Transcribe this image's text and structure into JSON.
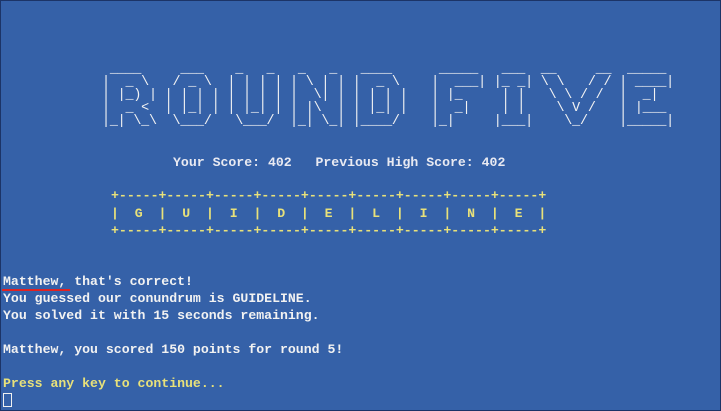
{
  "banner": {
    "title": "ROUND FIVE",
    "art": [
      " ____     ___    _   _   _   _   ____      _____   ___  __     __  _____ ",
      "|  _ \\   / _ \\  | | | | | \\ | | |  _ \\    |  ___| |_ _| \\ \\   / / | ____|",
      "| |_) | | | | | | | | | |  \\| | | | | |   | |_     | |   \\ \\ / /  |  _|  ",
      "|  _ <  | |_| | | |_| | | |\\  | | |_| |   |  _|    | |    \\ V /   | |___ ",
      "|_| \\_\\  \\___/   \\___/  |_| \\_| |____/    |_|     |___|    \\_/    |_____|"
    ]
  },
  "scores": {
    "line": "Your Score: 402   Previous High Score: 402"
  },
  "board": {
    "border": "+-----+-----+-----+-----+-----+-----+-----+-----+-----+",
    "letters_row": "|  G  |  U  |  I  |  D  |  E  |  L  |  I  |  N  |  E  |"
  },
  "messages": {
    "player_name": "Matthew",
    "correct_suffix": ", that's correct!",
    "conundrum": "You guessed our conundrum is GUIDELINE.",
    "time": "You solved it with 15 seconds remaining.",
    "points": "Matthew, you scored 150 points for round 5!",
    "prompt": "Press any key to continue..."
  },
  "colors": {
    "background": "#3561a8",
    "text": "#f2f2f2",
    "highlight": "#e8e17a",
    "underline": "#e02222"
  }
}
